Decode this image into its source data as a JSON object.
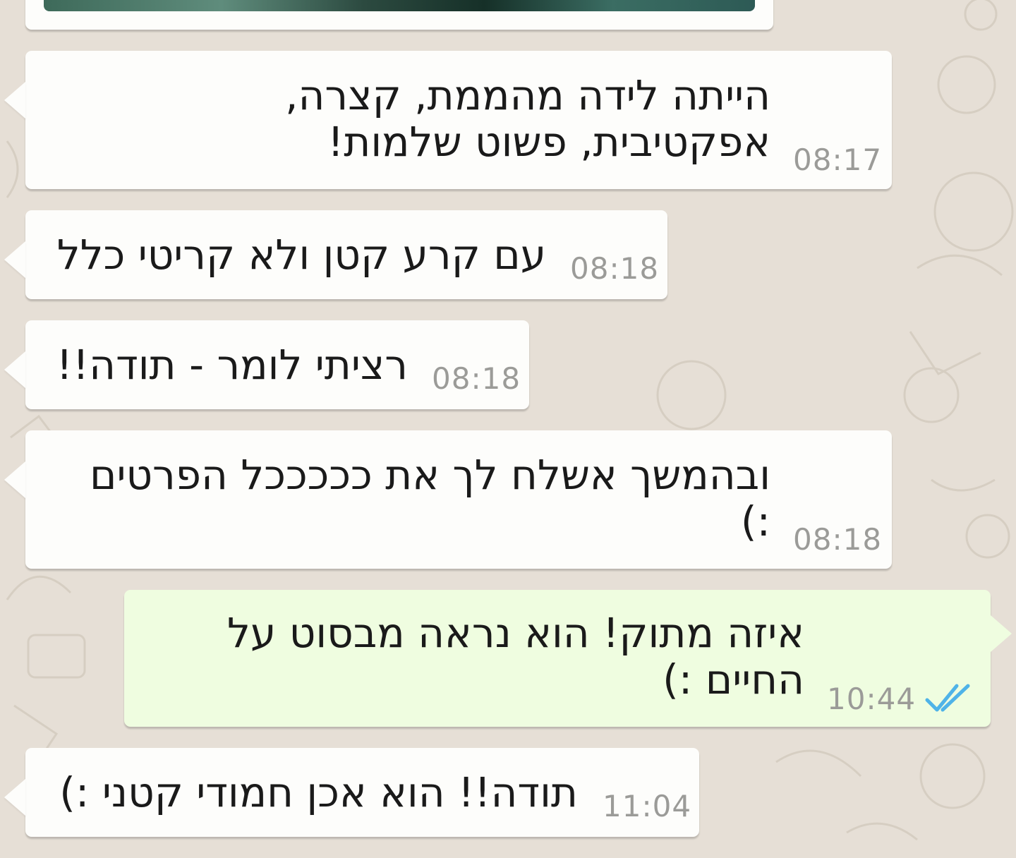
{
  "theme": {
    "wallpaper": "#e6dfd6",
    "incoming_bubble": "#fdfdfb",
    "outgoing_bubble": "#effde0",
    "timestamp": "#9b9b98",
    "read_ticks": "#4fb3e8"
  },
  "messages": [
    {
      "direction": "incoming",
      "text": "הייתה לידה מהממת, קצרה,\nאפקטיבית, פשוט שלמות!",
      "time": "08:17"
    },
    {
      "direction": "incoming",
      "text": "עם קרע קטן ולא קריטי כלל",
      "time": "08:18"
    },
    {
      "direction": "incoming",
      "text": "רציתי לומר - תודה!!",
      "time": "08:18"
    },
    {
      "direction": "incoming",
      "text": "ובהמשך אשלח לך את כככככל הפרטים\n:)",
      "time": "08:18"
    },
    {
      "direction": "outgoing",
      "text": "איזה מתוק! הוא נראה מבסוט על\nהחיים :)",
      "time": "10:44",
      "status_icon": "double-check-read-icon"
    },
    {
      "direction": "incoming",
      "text": "תודה!! הוא אכן חמודי קטני :)",
      "time": "11:04"
    }
  ]
}
